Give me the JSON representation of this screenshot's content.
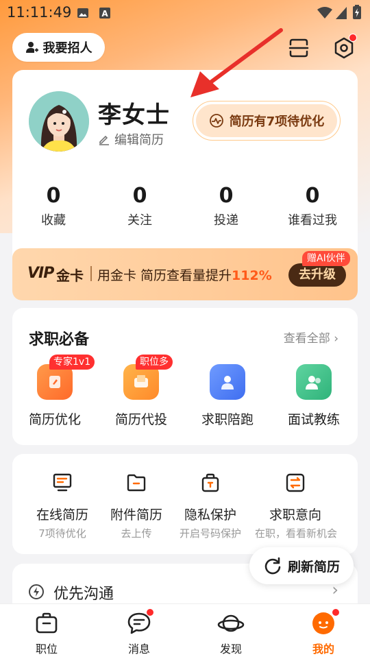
{
  "status_bar": {
    "time": "11:11:49"
  },
  "header": {
    "recruit_label": "我要招人"
  },
  "profile": {
    "name": "李女士",
    "edit_label": "编辑简历",
    "optimize_label": "简历有7项待优化",
    "stats": [
      {
        "value": "0",
        "label": "收藏"
      },
      {
        "value": "0",
        "label": "关注"
      },
      {
        "value": "0",
        "label": "投递"
      },
      {
        "value": "0",
        "label": "谁看过我"
      }
    ]
  },
  "vip": {
    "logo": "VIP",
    "card": "金卡",
    "text": "用金卡 简历查看量提升",
    "highlight": "112%",
    "tag": "赠AI伙伴",
    "upgrade_label": "去升级"
  },
  "job_essentials": {
    "title": "求职必备",
    "see_all": "查看全部",
    "items": [
      {
        "label": "简历优化",
        "badge": "专家1v1"
      },
      {
        "label": "简历代投",
        "badge": "职位多"
      },
      {
        "label": "求职陪跑",
        "badge": ""
      },
      {
        "label": "面试教练",
        "badge": ""
      }
    ]
  },
  "resume_tools": [
    {
      "title": "在线简历",
      "sub": "7项待优化"
    },
    {
      "title": "附件简历",
      "sub": "去上传"
    },
    {
      "title": "隐私保护",
      "sub": "开启号码保护"
    },
    {
      "title": "求职意向",
      "sub": "在职，看看新机会"
    }
  ],
  "refresh_label": "刷新简历",
  "priority": {
    "title": "优先沟通"
  },
  "nav": [
    {
      "label": "职位",
      "icon": "briefcase-icon"
    },
    {
      "label": "消息",
      "icon": "chat-icon"
    },
    {
      "label": "发现",
      "icon": "planet-icon"
    },
    {
      "label": "我的",
      "icon": "profile-icon"
    }
  ],
  "colors": {
    "accent": "#ff6a00",
    "badge_red": "#ff3030",
    "vip_dark": "#4a2a14"
  }
}
